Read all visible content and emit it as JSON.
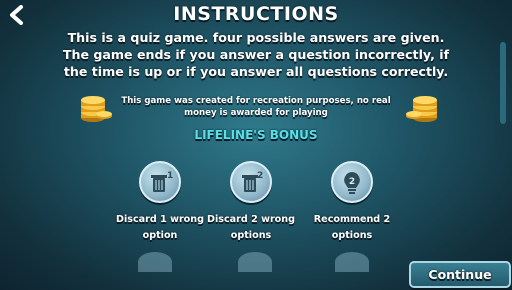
{
  "header": {
    "title": "INSTRUCTIONS",
    "back_icon": "back-arrow-icon"
  },
  "intro_text": "This is a quiz game. four possible answers are given. The game ends if you answer a question incorrectly, if the time is up or if you answer all questions correctly.",
  "disclaimer": "This game was created for recreation purposes, no real money is awarded for playing",
  "lifelines": {
    "heading": "LIFELINE'S BONUS",
    "items": [
      {
        "label": "Discard 1 wrong option",
        "icon": "discard-one-icon",
        "badge": "1"
      },
      {
        "label": "Discard 2 wrong options",
        "icon": "discard-two-icon",
        "badge": "2"
      },
      {
        "label": "Recommend 2 options",
        "icon": "recommend-icon",
        "badge": "2"
      }
    ]
  },
  "footer": {
    "continue_label": "Continue"
  },
  "colors": {
    "heading_accent": "#56e0e8",
    "background": "#1f5566",
    "coin_gold": "#f2b632"
  }
}
